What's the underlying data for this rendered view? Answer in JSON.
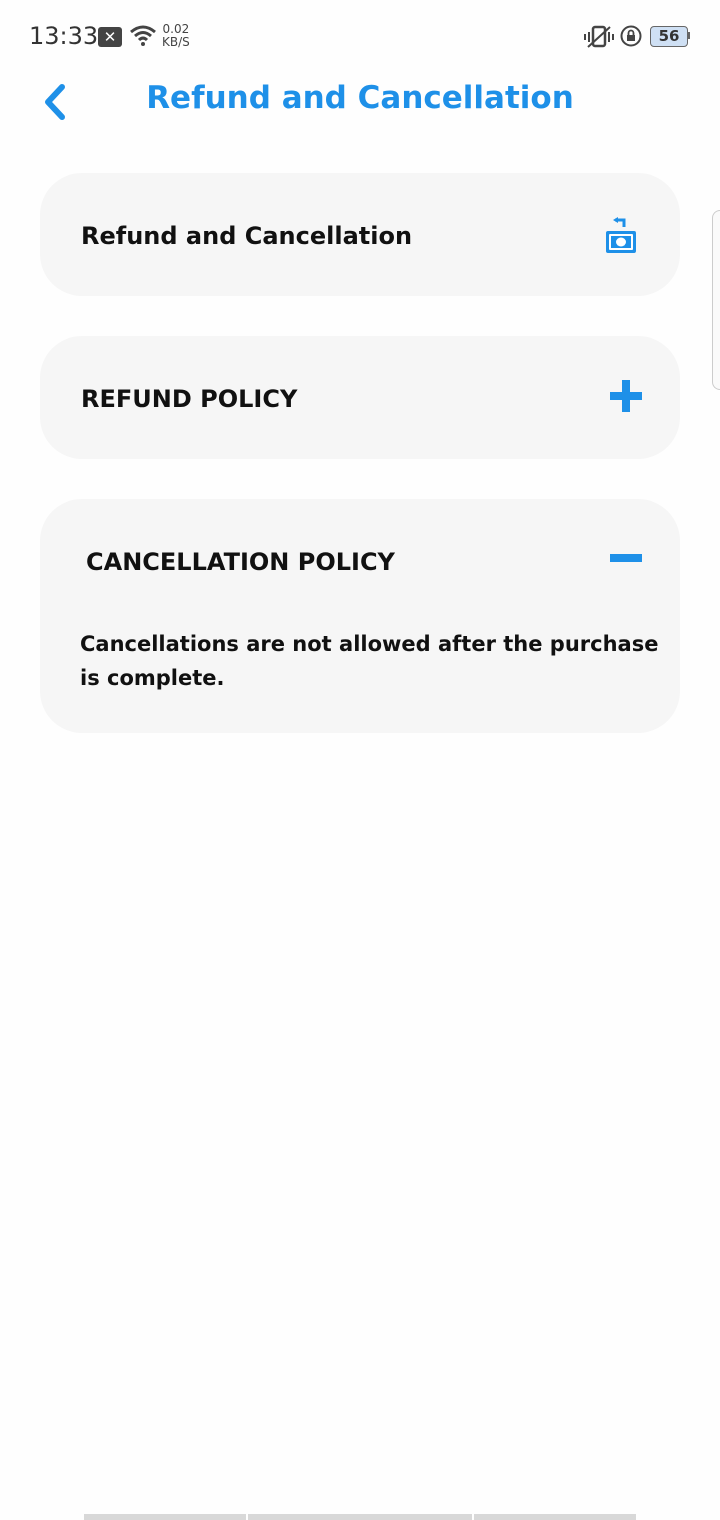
{
  "status_bar": {
    "time": "13:33",
    "net_speed_value": "0.02",
    "net_speed_unit": "KB/S",
    "battery": "56"
  },
  "header": {
    "title": "Refund and Cancellation",
    "back_icon": "chevron-left-icon"
  },
  "sections": [
    {
      "label": "Refund and Cancellation",
      "icon": "refund-money-icon"
    },
    {
      "label": "REFUND POLICY",
      "icon": "plus-icon",
      "expanded": false
    },
    {
      "label": "CANCELLATION POLICY",
      "icon": "minus-icon",
      "expanded": true,
      "body": "Cancellations are not allowed after the purchase is complete."
    }
  ],
  "colors": {
    "accent": "#1e90e8",
    "card_bg": "#f6f6f6",
    "text": "#111111"
  }
}
